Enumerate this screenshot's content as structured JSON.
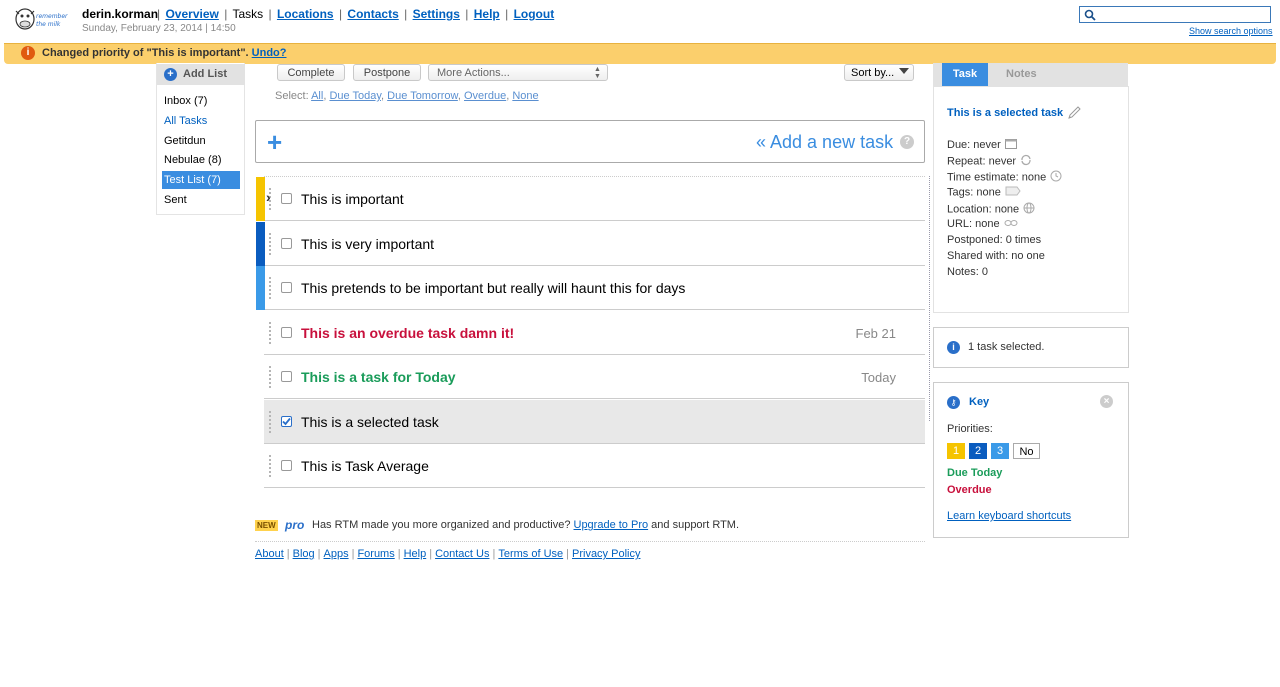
{
  "header": {
    "username": "derin.korman",
    "datetime": "Sunday, February 23, 2014 | 14:50",
    "nav": [
      "Overview",
      "Tasks",
      "Locations",
      "Contacts",
      "Settings",
      "Help",
      "Logout"
    ],
    "search_placeholder": "",
    "search_options": "Show search options",
    "logo_text": "remember the milk"
  },
  "notification": {
    "text": "Changed priority of \"This is important\".",
    "undo": "Undo?"
  },
  "lists": {
    "add_label": "Add List",
    "items": [
      {
        "label": "Inbox (7)",
        "state": "normal"
      },
      {
        "label": "All Tasks",
        "state": "link"
      },
      {
        "label": "Getitdun",
        "state": "normal"
      },
      {
        "label": "Nebulae (8)",
        "state": "normal"
      },
      {
        "label": "Test List (7)",
        "state": "active"
      },
      {
        "label": "Sent",
        "state": "normal"
      }
    ]
  },
  "toolbar": {
    "complete": "Complete",
    "postpone": "Postpone",
    "more_actions": "More Actions...",
    "sort": "Sort by...",
    "select_label": "Select:",
    "select_options": [
      "All",
      "Due Today",
      "Due Tomorrow",
      "Overdue",
      "None"
    ]
  },
  "add_task": {
    "plus": "+",
    "label": "« Add a new task",
    "help": "?"
  },
  "tasks": [
    {
      "name": "This is important",
      "date": "",
      "priority_color": "#f5c400",
      "style": "normal",
      "checked": false,
      "selected": false
    },
    {
      "name": "This is very important",
      "date": "",
      "priority_color": "#0a5cbf",
      "style": "normal",
      "checked": false,
      "selected": false
    },
    {
      "name": "This pretends to be important but really will haunt this for days",
      "date": "",
      "priority_color": "#3a9ae8",
      "style": "normal",
      "checked": false,
      "selected": false
    },
    {
      "name": "This is an overdue task damn it!",
      "date": "Feb 21",
      "priority_color": "",
      "style": "overdue",
      "checked": false,
      "selected": false
    },
    {
      "name": "This is a task for Today",
      "date": "Today",
      "priority_color": "",
      "style": "today",
      "checked": false,
      "selected": false
    },
    {
      "name": "This is a selected task",
      "date": "",
      "priority_color": "",
      "style": "normal",
      "checked": true,
      "selected": true
    },
    {
      "name": "This is Task Average",
      "date": "",
      "priority_color": "",
      "style": "normal",
      "checked": false,
      "selected": false
    }
  ],
  "pro": {
    "new": "NEW",
    "logo": "pro",
    "text_before": "Has RTM made you more organized and productive?",
    "link": "Upgrade to Pro",
    "text_after": "and support RTM."
  },
  "footer_links": [
    "About",
    "Blog",
    "Apps",
    "Forums",
    "Help",
    "Contact Us",
    "Terms of Use",
    "Privacy Policy"
  ],
  "detail": {
    "tab_task": "Task",
    "tab_notes": "Notes",
    "title": "This is a selected task",
    "lines": [
      {
        "text": "Due: never",
        "icon": "calendar-icon"
      },
      {
        "text": "Repeat: never",
        "icon": "repeat-icon"
      },
      {
        "text": "Time estimate: none",
        "icon": "clock-icon"
      },
      {
        "text": "Tags: none",
        "icon": "tag-icon"
      },
      {
        "text": "Location: none",
        "icon": "globe-icon"
      },
      {
        "text": "URL: none",
        "icon": "link-icon"
      },
      {
        "text": "Postponed: 0 times",
        "icon": ""
      },
      {
        "text": "Shared with: no one",
        "icon": ""
      },
      {
        "text": "Notes: 0",
        "icon": ""
      }
    ]
  },
  "info": {
    "text": "1 task selected."
  },
  "key": {
    "title": "Key",
    "priorities_label": "Priorities:",
    "priorities": [
      {
        "label": "1",
        "color": "#f5c400"
      },
      {
        "label": "2",
        "color": "#0a5cbf"
      },
      {
        "label": "3",
        "color": "#3a9ae8"
      },
      {
        "label": "No",
        "color": "#ffffff"
      }
    ],
    "due_today": "Due Today",
    "overdue": "Overdue",
    "shortcuts": "Learn keyboard shortcuts"
  },
  "colors": {
    "accent": "#3a8de0",
    "link": "#0060bf",
    "overdue": "#c8103c",
    "today": "#1a9c5a",
    "notification": "#fbcf6c"
  }
}
